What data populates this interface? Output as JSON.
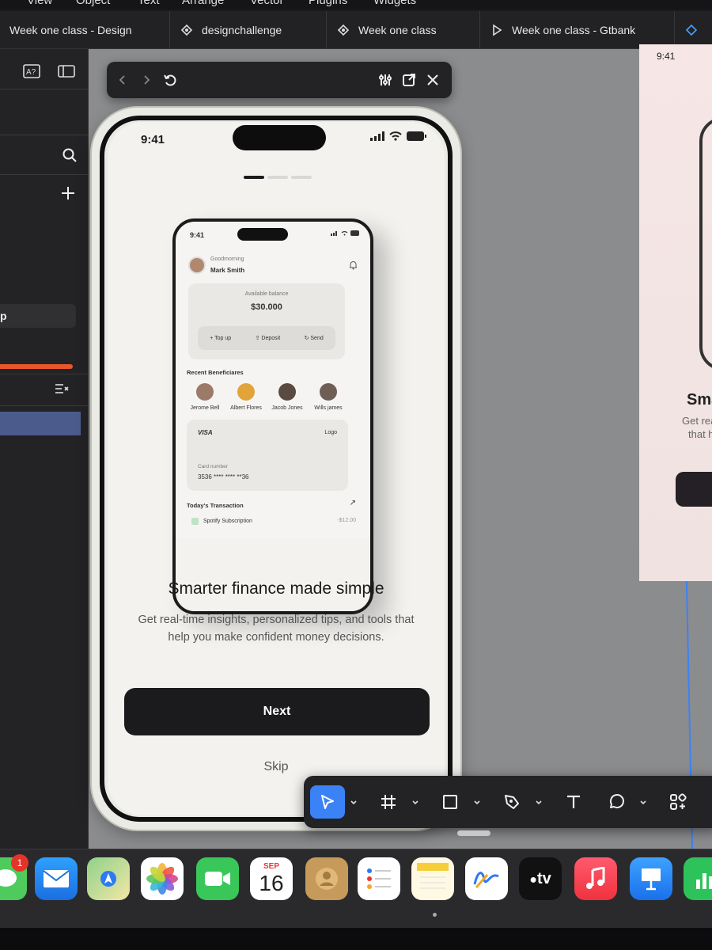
{
  "menubar": {
    "items": [
      "View",
      "Object",
      "Text",
      "Arrange",
      "Vector",
      "Plugins",
      "Widgets"
    ]
  },
  "tabs": [
    {
      "label": "Week one class - Design",
      "icon": "none"
    },
    {
      "label": "designchallenge",
      "icon": "figjam-icon"
    },
    {
      "label": "Week one class",
      "icon": "figjam-icon"
    },
    {
      "label": "Week one class - Gtbank",
      "icon": "play-icon"
    }
  ],
  "left_panel": {
    "item_label": "p"
  },
  "right_frame": {
    "time": "9:41",
    "title": "Sma",
    "line1": "Get rea",
    "line2": "that h"
  },
  "phone": {
    "time": "9:41",
    "headline": "Smarter finance made simple",
    "subtitle": "Get real-time insights, personalized tips, and tools that help you make confident money decisions.",
    "next_label": "Next",
    "skip_label": "Skip",
    "pager_active": 1,
    "pager_count": 3
  },
  "mini": {
    "time": "9:41",
    "greeting": "Goodmorning",
    "name": "Mark Smith",
    "balance_label": "Available balance",
    "balance": "$30.000",
    "actions": [
      "Top up",
      "Deposit",
      "Send"
    ],
    "beneficiaries_title": "Recent Beneficiares",
    "beneficiaries": [
      "Jerome Bell",
      "Albert Flores",
      "Jacob Jones",
      "Wills james"
    ],
    "card_brand": "VISA",
    "card_logo": "Logo",
    "card_number_label": "Card number",
    "card_number": "3536 **** **** **36",
    "transactions_title": "Today's Transaction",
    "tx_name": "Spotify Subscription",
    "tx_amount": "-$12.00"
  },
  "dock": {
    "badge": "1",
    "calendar_month": "SEP",
    "calendar_day": "16",
    "tv_label": "tv",
    "apps": [
      "messages-icon",
      "mail-icon",
      "maps-icon",
      "photos-icon",
      "facetime-icon",
      "calendar-icon",
      "contacts-icon",
      "reminders-icon",
      "notes-icon",
      "freeform-icon",
      "appletv-icon",
      "music-icon",
      "keynote-icon",
      "numbers-icon"
    ]
  },
  "colors": {
    "accent": "#3b82f6",
    "button": "#1b1b1d",
    "canvas": "#8b8c8e"
  }
}
